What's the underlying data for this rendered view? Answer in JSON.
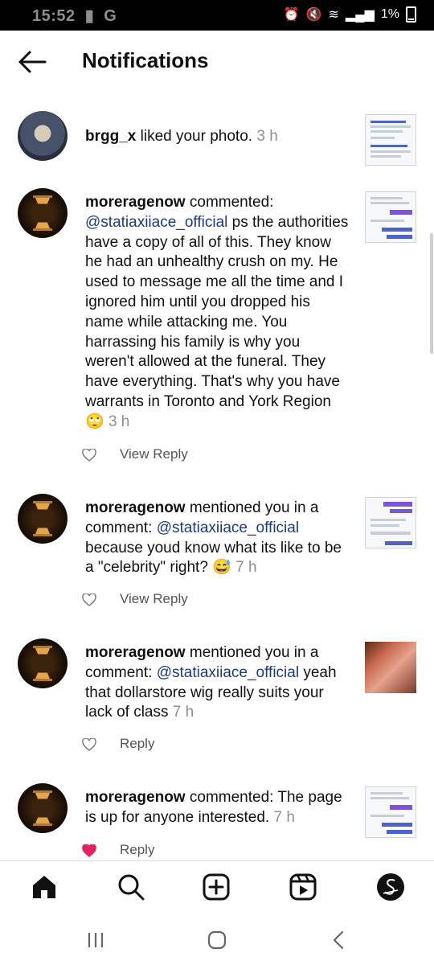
{
  "status_bar": {
    "time": "15:52",
    "app_badge": "G",
    "battery": "1%"
  },
  "header": {
    "title": "Notifications"
  },
  "notifications": [
    {
      "username": "brgg_x",
      "body": " liked your photo.",
      "time": "3 h"
    },
    {
      "username": "moreragenow",
      "prefix": " commented: ",
      "mention": "@statiaxiiace_official",
      "body": " ps the authorities have a copy of all of this. They know he had an unhealthy crush on my. He used to message me all the time and I ignored him until you dropped his name while attacking me. You harrassing his family is why you weren't allowed at the funeral. They have everything. That's why you have warrants in Toronto and York Region ",
      "emoji": "🙄",
      "time": "3 h",
      "action": "View Reply"
    },
    {
      "username": "moreragenow",
      "prefix": " mentioned you in a comment: ",
      "mention": "@statiaxiiace_official",
      "body": " because youd know what its like to be a \"celebrity\" right? ",
      "emoji": "😅",
      "time": "7 h",
      "action": "View Reply"
    },
    {
      "username": "moreragenow",
      "prefix": " mentioned you in a comment: ",
      "mention": "@statiaxiiace_official",
      "body": " yeah that dollarstore wig really suits your lack of class",
      "time": "7 h",
      "action": "Reply"
    },
    {
      "username": "moreragenow",
      "prefix": " commented: ",
      "body": "The page is up for anyone interested.",
      "time": "7 h",
      "action": "Reply",
      "liked": true
    }
  ],
  "nav_icons": [
    "home-icon",
    "search-icon",
    "create-icon",
    "reels-icon",
    "profile-icon"
  ],
  "colors": {
    "mention": "#1f3a7a",
    "time": "#8e8e8e",
    "liked_heart": "#e0245e"
  }
}
